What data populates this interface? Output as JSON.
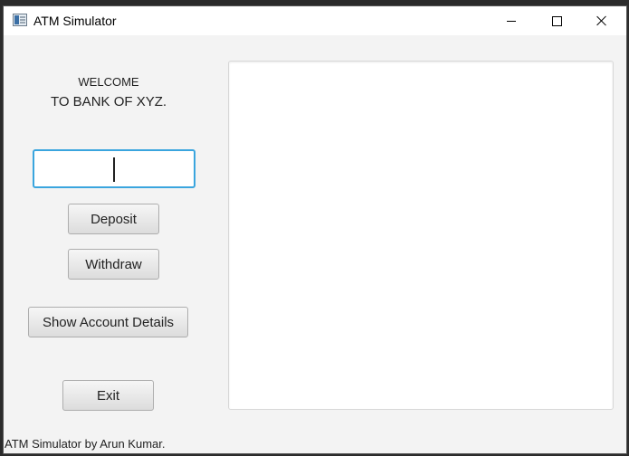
{
  "window": {
    "title": "ATM Simulator",
    "controls": {
      "minimize": "minimize",
      "maximize": "maximize",
      "close": "close"
    }
  },
  "welcome": {
    "line1": "WELCOME",
    "line2": "TO BANK OF XYZ."
  },
  "amount_input": {
    "value": "",
    "placeholder": ""
  },
  "buttons": {
    "deposit": "Deposit",
    "withdraw": "Withdraw",
    "show_details": "Show Account Details",
    "exit": "Exit"
  },
  "output": {
    "text": ""
  },
  "footer": "ATM Simulator by Arun Kumar.",
  "colors": {
    "focus_border": "#3aa5de",
    "window_bg": "#f3f3f3",
    "titlebar_bg": "#ffffff"
  }
}
